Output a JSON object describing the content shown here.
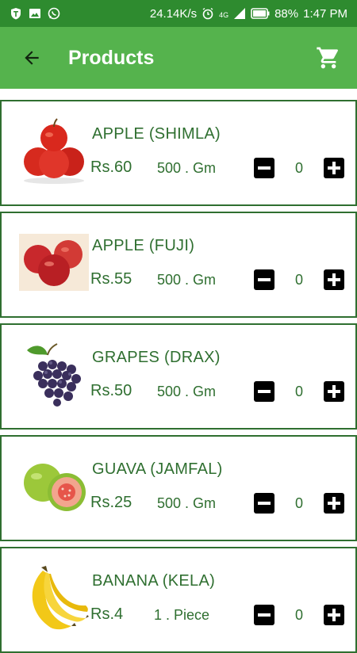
{
  "status_bar": {
    "network_speed": "24.14K/s",
    "network_type": "4G",
    "battery": "88%",
    "time": "1:47 PM"
  },
  "app_bar": {
    "title": "Products"
  },
  "colors": {
    "status_bar": "#2e8b2f",
    "app_bar": "#55b34d",
    "text_green": "#2f6f30",
    "card_border": "#2f6f30"
  },
  "products": [
    {
      "name": "APPLE (SHIMLA)",
      "price": "Rs.60",
      "unit": "500 . Gm",
      "qty": "0",
      "icon": "apple-shimla-icon"
    },
    {
      "name": "APPLE (FUJI)",
      "price": "Rs.55",
      "unit": "500 . Gm",
      "qty": "0",
      "icon": "apple-fuji-icon"
    },
    {
      "name": "GRAPES (DRAX)",
      "price": "Rs.50",
      "unit": "500 . Gm",
      "qty": "0",
      "icon": "grapes-icon"
    },
    {
      "name": "GUAVA (JAMFAL)",
      "price": "Rs.25",
      "unit": "500 . Gm",
      "qty": "0",
      "icon": "guava-icon"
    },
    {
      "name": "BANANA (KELA)",
      "price": "Rs.4",
      "unit": "1 . Piece",
      "qty": "0",
      "icon": "banana-icon"
    }
  ]
}
